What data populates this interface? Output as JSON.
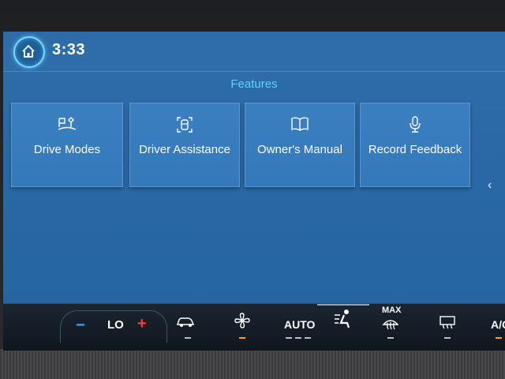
{
  "header": {
    "time": "3:33"
  },
  "features": {
    "title": "Features",
    "tiles": [
      {
        "label": "Drive Modes",
        "icon": "drive-modes-icon"
      },
      {
        "label": "Driver Assistance",
        "icon": "driver-assistance-icon"
      },
      {
        "label": "Owner's Manual",
        "icon": "book-icon"
      },
      {
        "label": "Record Feedback",
        "icon": "microphone-icon"
      }
    ],
    "more": "‹"
  },
  "climate": {
    "minus": "−",
    "temp": "LO",
    "plus": "+",
    "auto": "AUTO",
    "max": "MAX",
    "ac": "A/C"
  },
  "colors": {
    "accent": "#5fd0ff",
    "tile": "#3479ba",
    "indicator_off": "#b8c2cc",
    "indicator_on": "#ff9f1a",
    "plus": "#ff3b3b",
    "minus": "#3aa9ff"
  }
}
